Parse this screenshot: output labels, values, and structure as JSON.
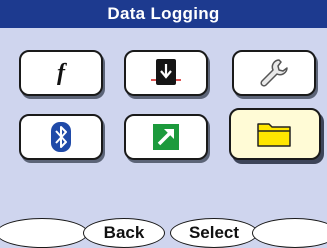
{
  "header": {
    "title": "Data Logging"
  },
  "tiles": [
    {
      "name": "function",
      "icon": "function-f-icon",
      "glyph": "f",
      "selected": false
    },
    {
      "name": "sensor-probe",
      "icon": "download-probe-icon",
      "selected": false
    },
    {
      "name": "settings",
      "icon": "wrench-icon",
      "selected": false
    },
    {
      "name": "bluetooth",
      "icon": "bluetooth-icon",
      "selected": false
    },
    {
      "name": "export",
      "icon": "arrow-out-icon",
      "selected": false
    },
    {
      "name": "files",
      "icon": "folder-icon",
      "selected": true
    }
  ],
  "softkeys": [
    "",
    "Back",
    "Select",
    ""
  ],
  "colors": {
    "background": "#cfd5ee",
    "title_bar": "#1d3a8f",
    "bluetooth": "#1f4aa8",
    "export_green": "#1c9a3c",
    "folder_yellow": "#ffe600",
    "selected_tile": "#fffbd6"
  }
}
